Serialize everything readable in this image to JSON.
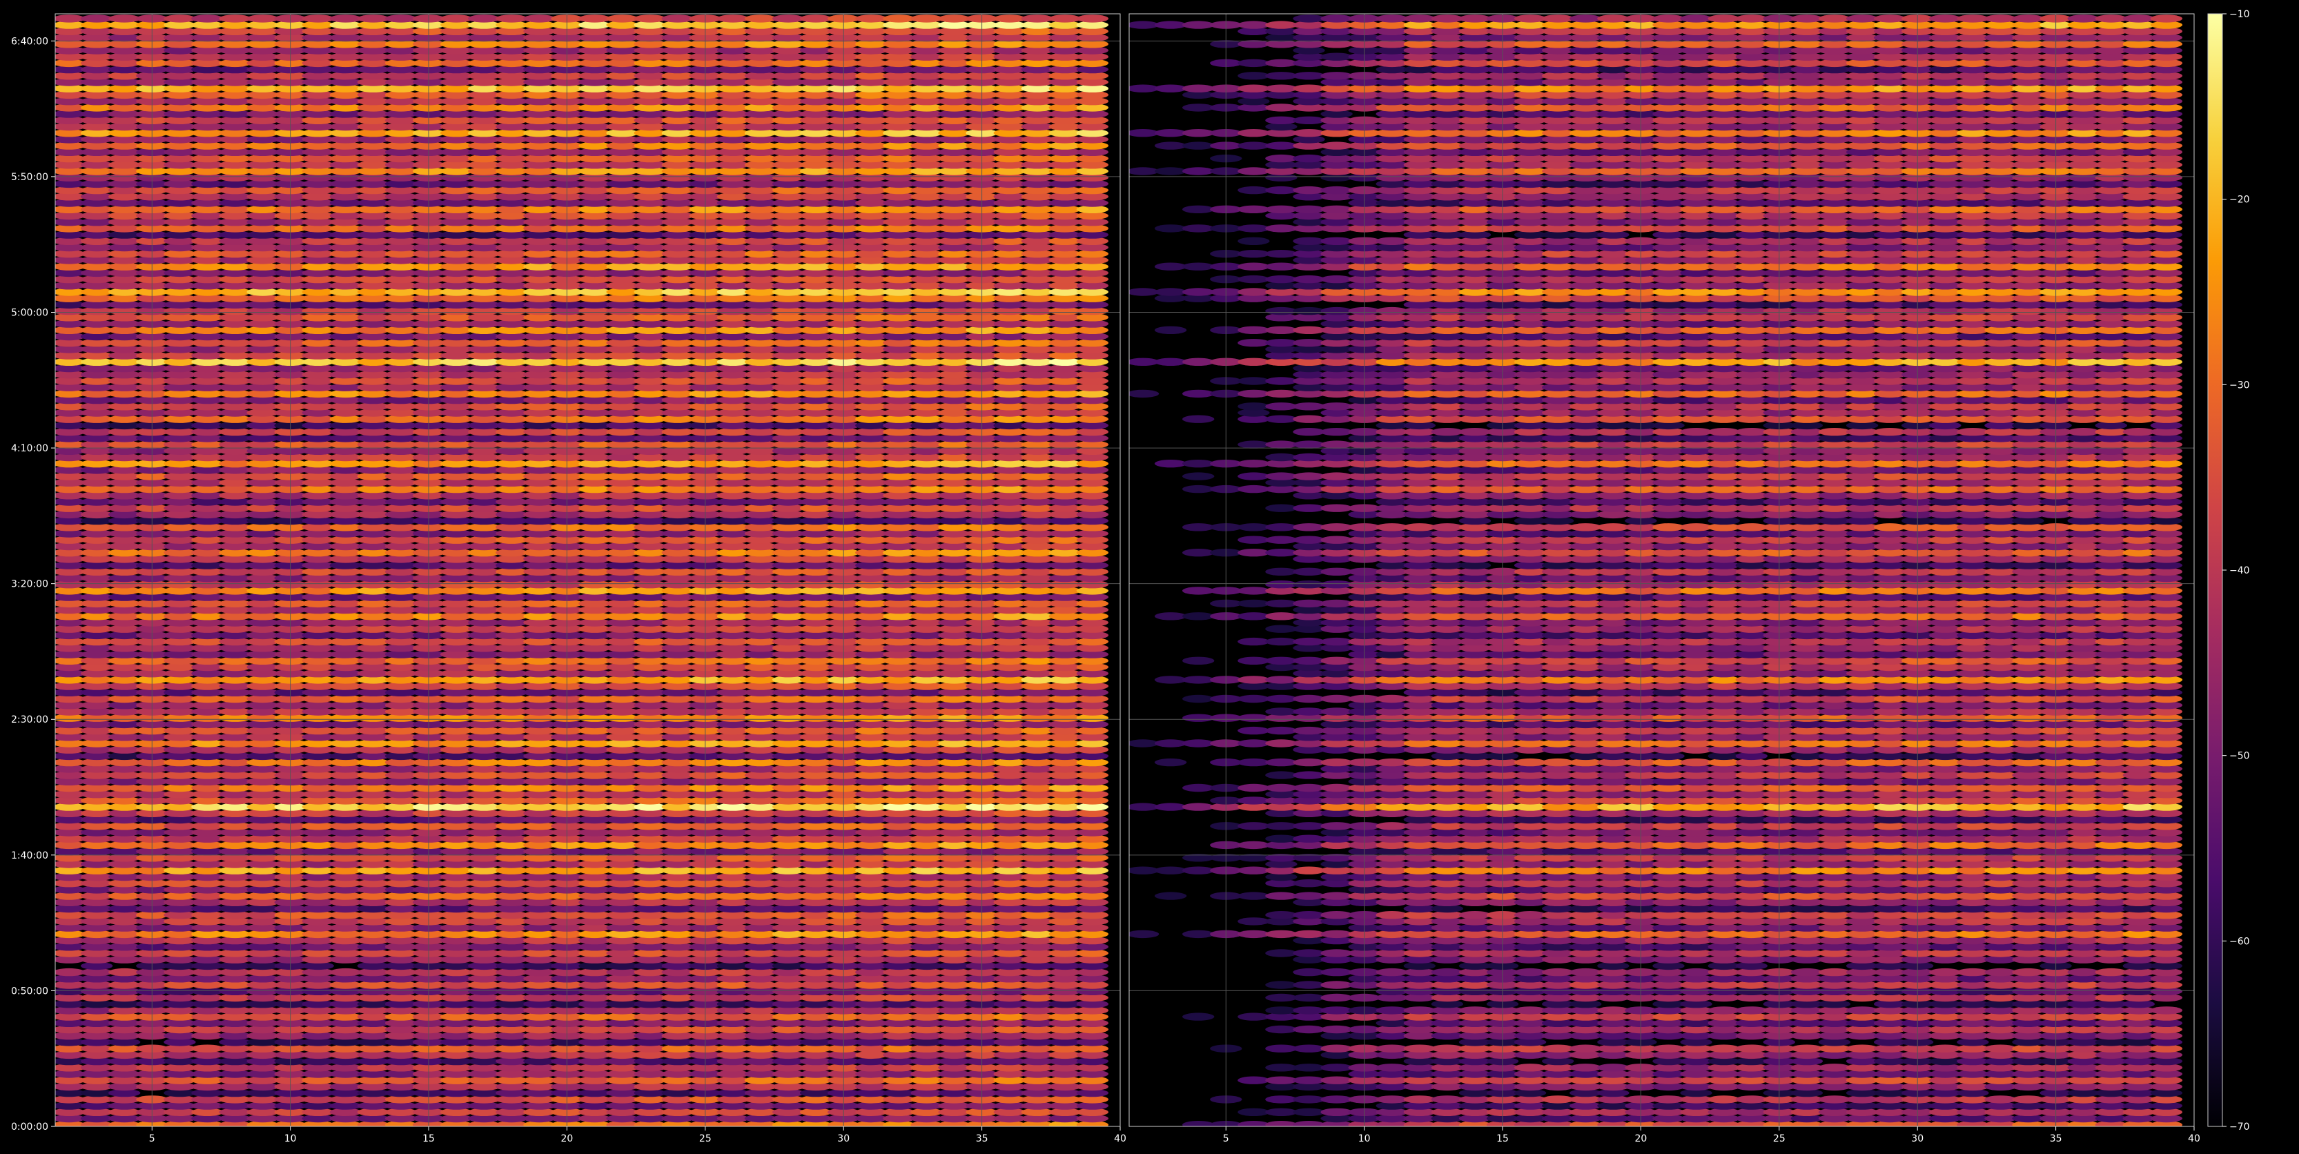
{
  "chart_data": {
    "type": "heatmap",
    "title": "",
    "layout": "two side-by-side heatmap panels sharing a y-axis and a vertical colorbar on the right",
    "background_color": "#000000",
    "grid": true,
    "grid_color": "#555555",
    "colormap": "inferno",
    "colormap_stops": [
      "#000004",
      "#1b0c41",
      "#4a0c6b",
      "#781c6d",
      "#a52c60",
      "#cf4446",
      "#ed6925",
      "#fb9b06",
      "#f7d13d",
      "#fcffa4"
    ],
    "colorbar": {
      "range": [
        -70,
        -10
      ],
      "ticks": [
        "−70",
        "−60",
        "−50",
        "−40",
        "−30",
        "−20",
        "−10"
      ],
      "tick_values": [
        -70,
        -60,
        -50,
        -40,
        -30,
        -20,
        -10
      ]
    },
    "y_axis": {
      "label": "",
      "range_seconds": [
        0,
        24600
      ],
      "ticks": [
        "0:00:00",
        "0:50:00",
        "1:40:00",
        "2:30:00",
        "3:20:00",
        "4:10:00",
        "5:00:00",
        "5:50:00",
        "6:40:00"
      ],
      "tick_seconds": [
        0,
        3000,
        6000,
        9000,
        12000,
        15000,
        18000,
        21000,
        24000
      ]
    },
    "panels": [
      {
        "x_range": [
          1.5,
          40
        ],
        "x_ticks": [
          "5",
          "10",
          "15",
          "20",
          "25",
          "30",
          "35",
          "40"
        ],
        "x_tick_values": [
          5,
          10,
          15,
          20,
          25,
          30,
          35,
          40
        ],
        "description": "Cells at x = 2..39; brighter toward top rows and toward right columns"
      },
      {
        "x_range": [
          1.5,
          40
        ],
        "x_ticks": [
          "5",
          "10",
          "15",
          "20",
          "25",
          "30",
          "35",
          "40"
        ],
        "x_tick_values": [
          5,
          10,
          15,
          20,
          25,
          30,
          35,
          40
        ],
        "description": "Cells at x = 2..39; left columns (2-10) mostly dark, values increase toward right"
      }
    ],
    "x_cells": [
      2,
      3,
      4,
      5,
      6,
      7,
      8,
      9,
      10,
      11,
      12,
      13,
      14,
      15,
      16,
      17,
      18,
      19,
      20,
      21,
      22,
      23,
      24,
      25,
      26,
      27,
      28,
      29,
      30,
      31,
      32,
      33,
      34,
      35,
      36,
      37,
      38,
      39
    ],
    "row_levels_note": "Approximate row mean levels in dB from bottom (0:00:00) to top (~6:50:00); derived visually",
    "row_levels": [
      -32,
      -52,
      -40,
      -55,
      -38,
      -60,
      -45,
      -35,
      -50,
      -42,
      -58,
      -44,
      -36,
      -60,
      -48,
      -40,
      -52,
      -35,
      -45,
      -60,
      -41,
      -55,
      -38,
      -50,
      -44,
      -62,
      -47,
      -39,
      -53,
      -43,
      -28,
      -48,
      -40,
      -36,
      -57,
      -45,
      -33,
      -50,
      -38,
      -46,
      -24,
      -44,
      -37,
      -52,
      -29,
      -41,
      -48,
      -36,
      -55,
      -40,
      -18,
      -35,
      -42,
      -30,
      -49,
      -38,
      -46,
      -31,
      -58,
      -43,
      -27,
      -44,
      -36,
      -51,
      -30,
      -42,
      -48,
      -35,
      -55,
      -39,
      -25,
      -46,
      -40,
      -33,
      -50,
      -44,
      -38,
      -52,
      -41,
      -47,
      -29,
      -43,
      -36,
      -53,
      -27,
      -40,
      -49,
      -38,
      -56,
      -42,
      -31,
      -45,
      -37,
      -50,
      -33,
      -61,
      -47,
      -39,
      -54,
      -44,
      -30,
      -42,
      -35,
      -49,
      -26,
      -41,
      -47,
      -36,
      -55,
      -40,
      -60,
      -32,
      -43,
      -37,
      -51,
      -28,
      -46,
      -38,
      -44,
      -48,
      -20,
      -39,
      -45,
      -34,
      -52,
      -29,
      -47,
      -36,
      -41,
      -55,
      -32,
      -22,
      -44,
      -38,
      -50,
      -27,
      -43,
      -35,
      -48,
      -40,
      -58,
      -33,
      -46,
      -39,
      -30,
      -52,
      -42,
      -37,
      -54,
      -45,
      -28,
      -41,
      -36,
      -49,
      -31,
      -47,
      -24,
      -43,
      -38,
      -51,
      -29,
      -44,
      -35,
      -22,
      -46,
      -40,
      -55,
      -33,
      -42,
      -48,
      -30,
      -45,
      -37,
      -20,
      -41
    ]
  }
}
